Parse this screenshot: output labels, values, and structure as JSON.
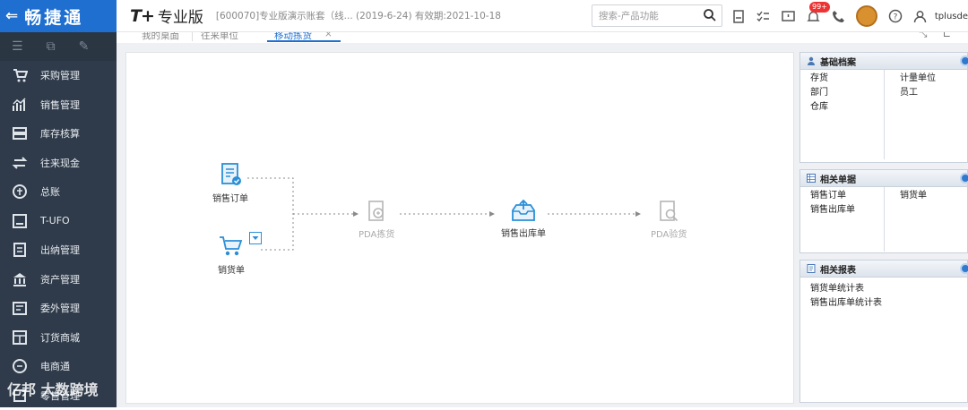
{
  "app": {
    "logo_text": "畅捷通",
    "brand": "T+",
    "edition": "专业版",
    "account_info": "[600070]专业版演示账套（线...  (2019-6-24)  有效期:2021-10-18",
    "username": "tplusde",
    "notification_badge": "99+"
  },
  "search": {
    "placeholder": "搜索-产品功能"
  },
  "sidebar": {
    "items": [
      {
        "label": "采购管理",
        "icon": "cart-icon"
      },
      {
        "label": "销售管理",
        "icon": "chart-icon"
      },
      {
        "label": "库存核算",
        "icon": "warehouse-icon"
      },
      {
        "label": "往来现金",
        "icon": "exchange-icon"
      },
      {
        "label": "总账",
        "icon": "ledger-icon"
      },
      {
        "label": "T-UFO",
        "icon": "ufo-icon"
      },
      {
        "label": "出纳管理",
        "icon": "cashier-icon"
      },
      {
        "label": "资产管理",
        "icon": "bank-icon"
      },
      {
        "label": "委外管理",
        "icon": "outsource-icon"
      },
      {
        "label": "订货商城",
        "icon": "store-icon"
      },
      {
        "label": "电商通",
        "icon": "ecommerce-icon"
      },
      {
        "label": "零售管理",
        "icon": "retail-icon"
      }
    ]
  },
  "tabs": [
    {
      "label": "我的桌面"
    },
    {
      "label": "往来单位"
    },
    {
      "label": "移动拣货"
    }
  ],
  "flow": {
    "nodes": {
      "sales_order": "销售订单",
      "sales_delivery": "销货单",
      "pda_picking": "PDA拣货",
      "sales_outbound": "销售出库单",
      "pda_verify": "PDA验货"
    }
  },
  "panels": {
    "basic": {
      "title": "基础档案",
      "left": [
        "存货",
        "部门",
        "仓库"
      ],
      "right": [
        "计量单位",
        "员工"
      ]
    },
    "docs": {
      "title": "相关单据",
      "left": [
        "销售订单",
        "销售出库单"
      ],
      "right": [
        "销货单"
      ]
    },
    "reports": {
      "title": "相关报表",
      "left": [
        "销货单统计表",
        "销售出库单统计表"
      ]
    }
  },
  "watermark": "亿邦 大数跨境",
  "colors": {
    "sidebar_bg": "#2f3b4a",
    "logo_bg": "#1e6fd0",
    "accent": "#1e6fd0",
    "flow_icon": "#2a8fd8"
  }
}
